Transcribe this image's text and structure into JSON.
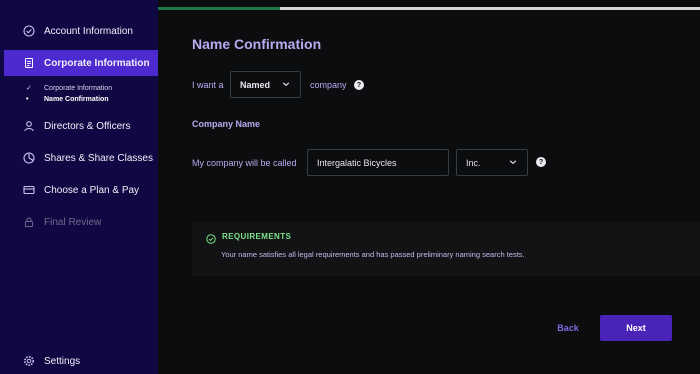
{
  "sidebar": {
    "items": [
      {
        "label": "Account Information",
        "icon": "check-circle-icon"
      },
      {
        "label": "Corporate Information",
        "icon": "document-icon"
      },
      {
        "label": "Directors & Officers",
        "icon": "person-icon"
      },
      {
        "label": "Shares & Share Classes",
        "icon": "pie-chart-icon"
      },
      {
        "label": "Choose a Plan & Pay",
        "icon": "credit-card-icon"
      },
      {
        "label": "Final Review",
        "icon": "lock-icon"
      }
    ],
    "subitems": [
      {
        "label": "Corporate Information",
        "mark": "✓"
      },
      {
        "label": "Name Confirmation",
        "mark": "•"
      }
    ],
    "settings_label": "Settings"
  },
  "progress": {
    "fraction": 0.226
  },
  "page": {
    "title": "Name Confirmation",
    "want_prefix": "I want a",
    "company_type": "Named",
    "want_suffix": "company",
    "section_title": "Company Name",
    "called_label": "My company will be called",
    "company_name": "Intergalatic Bicycles",
    "suffix": "Inc."
  },
  "requirements": {
    "title": "REQUIREMENTS",
    "text": "Your name satisfies all legal requirements and has passed preliminary naming search tests."
  },
  "actions": {
    "back_label": "Back",
    "next_label": "Next"
  },
  "colors": {
    "accent": "#4c2ad0",
    "sidebar": "#100843",
    "success": "#7ee28b",
    "heading": "#b7acf2"
  }
}
